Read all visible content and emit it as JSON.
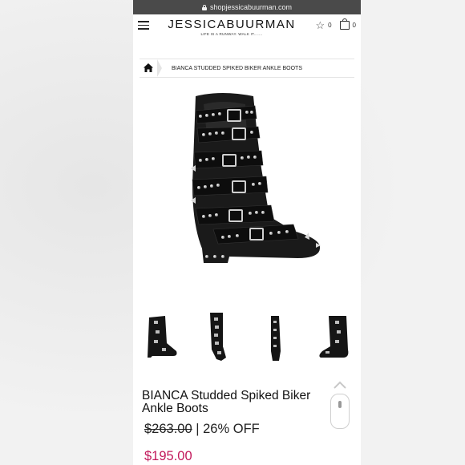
{
  "browser": {
    "url": "shopjessicabuurman.com"
  },
  "header": {
    "brand_name": "JESSICABUURMAN",
    "tagline": "LIFE IS A RUNWAY. WALK IT.......",
    "wishlist_count": "0",
    "cart_count": "0",
    "icons": [
      "menu-icon",
      "star-icon",
      "bag-icon"
    ]
  },
  "breadcrumb": {
    "current": "BIANCA STUDDED SPIKED BIKER ANKLE BOOTS"
  },
  "product": {
    "title": "BIANCA Studded Spiked Biker Ankle Boots",
    "original_price": "$263.00",
    "discount": "| 26% OFF",
    "sale_price": "$195.00",
    "thumbnails": [
      "front",
      "side",
      "back",
      "side-strap"
    ]
  },
  "colors": {
    "sale_price": "#c2185b",
    "url_bar": "#4a4a4a"
  }
}
